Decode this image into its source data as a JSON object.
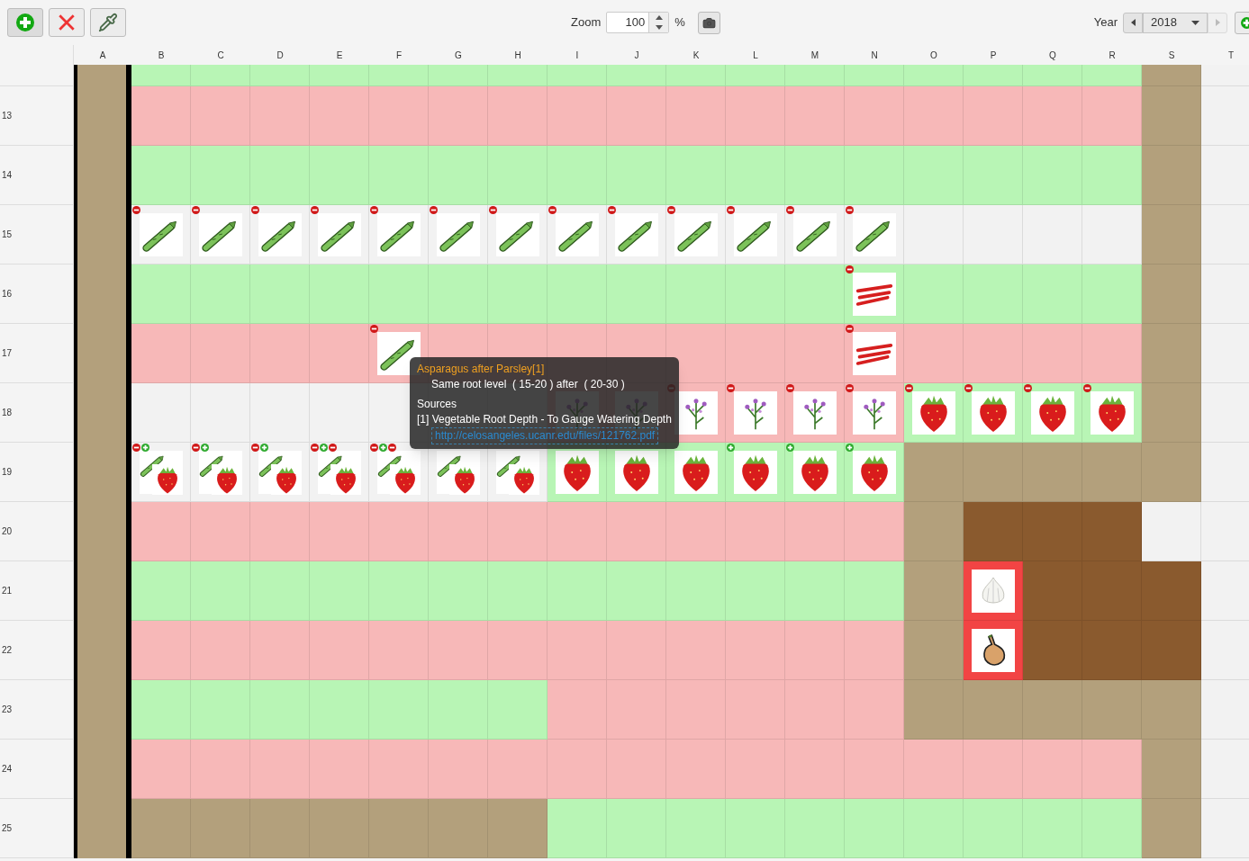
{
  "toolbar": {
    "buttons": [
      {
        "kind": "add"
      },
      {
        "kind": "delete"
      },
      {
        "kind": "pick"
      }
    ],
    "zoom": {
      "label": "Zoom",
      "value": "100",
      "unit": "%"
    },
    "year": {
      "label": "Year",
      "value": "2018",
      "prev_disabled": false,
      "next_disabled": true
    }
  },
  "columns": [
    "A",
    "B",
    "C",
    "D",
    "E",
    "F",
    "G",
    "H",
    "I",
    "J",
    "K",
    "L",
    "M",
    "N",
    "O",
    "P",
    "Q",
    "R",
    "S",
    "T"
  ],
  "rows": [
    {
      "cells": [
        {
          "kind": "path"
        },
        {
          "kind": "green"
        },
        {
          "kind": "green"
        },
        {
          "kind": "green"
        },
        {
          "kind": "green"
        },
        {
          "kind": "green"
        },
        {
          "kind": "green"
        },
        {
          "kind": "green"
        },
        {
          "kind": "green"
        },
        {
          "kind": "green"
        },
        {
          "kind": "green"
        },
        {
          "kind": "green"
        },
        {
          "kind": "green"
        },
        {
          "kind": "green"
        },
        {
          "kind": "green"
        },
        {
          "kind": "green"
        },
        {
          "kind": "green"
        },
        {
          "kind": "green"
        },
        {
          "kind": "path"
        },
        {
          "kind": "empty"
        }
      ]
    },
    {
      "label": "13",
      "cells": [
        {
          "kind": "path"
        },
        {
          "kind": "red"
        },
        {
          "kind": "red"
        },
        {
          "kind": "red"
        },
        {
          "kind": "red"
        },
        {
          "kind": "red"
        },
        {
          "kind": "red"
        },
        {
          "kind": "red"
        },
        {
          "kind": "red"
        },
        {
          "kind": "red"
        },
        {
          "kind": "red"
        },
        {
          "kind": "red"
        },
        {
          "kind": "red"
        },
        {
          "kind": "red"
        },
        {
          "kind": "red"
        },
        {
          "kind": "red"
        },
        {
          "kind": "red"
        },
        {
          "kind": "red"
        },
        {
          "kind": "path"
        },
        {
          "kind": "empty"
        }
      ]
    },
    {
      "label": "14",
      "cells": [
        {
          "kind": "path"
        },
        {
          "kind": "green"
        },
        {
          "kind": "green"
        },
        {
          "kind": "green"
        },
        {
          "kind": "green"
        },
        {
          "kind": "green"
        },
        {
          "kind": "green"
        },
        {
          "kind": "green"
        },
        {
          "kind": "green"
        },
        {
          "kind": "green"
        },
        {
          "kind": "green"
        },
        {
          "kind": "green"
        },
        {
          "kind": "green"
        },
        {
          "kind": "green"
        },
        {
          "kind": "green"
        },
        {
          "kind": "green"
        },
        {
          "kind": "green"
        },
        {
          "kind": "green"
        },
        {
          "kind": "path"
        },
        {
          "kind": "empty"
        }
      ]
    },
    {
      "label": "15",
      "cells": [
        {
          "kind": "path"
        },
        {
          "kind": "empty",
          "plant": {
            "kind": "asparagus"
          },
          "marks": [
            {
              "kind": "minus"
            }
          ]
        },
        {
          "kind": "empty",
          "plant": {
            "kind": "asparagus"
          },
          "marks": [
            {
              "kind": "minus"
            }
          ]
        },
        {
          "kind": "empty",
          "plant": {
            "kind": "asparagus"
          },
          "marks": [
            {
              "kind": "minus"
            }
          ]
        },
        {
          "kind": "empty",
          "plant": {
            "kind": "asparagus"
          },
          "marks": [
            {
              "kind": "minus"
            }
          ]
        },
        {
          "kind": "empty",
          "plant": {
            "kind": "asparagus"
          },
          "marks": [
            {
              "kind": "minus"
            }
          ]
        },
        {
          "kind": "empty",
          "plant": {
            "kind": "asparagus"
          },
          "marks": [
            {
              "kind": "minus"
            }
          ]
        },
        {
          "kind": "empty",
          "plant": {
            "kind": "asparagus"
          },
          "marks": [
            {
              "kind": "minus"
            }
          ]
        },
        {
          "kind": "empty",
          "plant": {
            "kind": "asparagus"
          },
          "marks": [
            {
              "kind": "minus"
            }
          ]
        },
        {
          "kind": "empty",
          "plant": {
            "kind": "asparagus"
          },
          "marks": [
            {
              "kind": "minus"
            }
          ]
        },
        {
          "kind": "empty",
          "plant": {
            "kind": "asparagus"
          },
          "marks": [
            {
              "kind": "minus"
            }
          ]
        },
        {
          "kind": "empty",
          "plant": {
            "kind": "asparagus"
          },
          "marks": [
            {
              "kind": "minus"
            }
          ]
        },
        {
          "kind": "empty",
          "plant": {
            "kind": "asparagus"
          },
          "marks": [
            {
              "kind": "minus"
            }
          ]
        },
        {
          "kind": "empty",
          "plant": {
            "kind": "asparagus"
          },
          "marks": [
            {
              "kind": "minus"
            }
          ]
        },
        {
          "kind": "empty"
        },
        {
          "kind": "empty"
        },
        {
          "kind": "empty"
        },
        {
          "kind": "empty"
        },
        {
          "kind": "path"
        },
        {
          "kind": "empty"
        }
      ]
    },
    {
      "label": "16",
      "cells": [
        {
          "kind": "path"
        },
        {
          "kind": "green"
        },
        {
          "kind": "green"
        },
        {
          "kind": "green"
        },
        {
          "kind": "green"
        },
        {
          "kind": "green"
        },
        {
          "kind": "green"
        },
        {
          "kind": "green"
        },
        {
          "kind": "green"
        },
        {
          "kind": "green"
        },
        {
          "kind": "green"
        },
        {
          "kind": "green"
        },
        {
          "kind": "green"
        },
        {
          "kind": "green",
          "plant": {
            "kind": "rhubarb"
          },
          "marks": [
            {
              "kind": "minus"
            }
          ]
        },
        {
          "kind": "green"
        },
        {
          "kind": "green"
        },
        {
          "kind": "green"
        },
        {
          "kind": "green"
        },
        {
          "kind": "path"
        },
        {
          "kind": "empty"
        }
      ]
    },
    {
      "label": "17",
      "cells": [
        {
          "kind": "path"
        },
        {
          "kind": "red"
        },
        {
          "kind": "red"
        },
        {
          "kind": "red"
        },
        {
          "kind": "red"
        },
        {
          "kind": "red",
          "plant": {
            "kind": "asparagus"
          },
          "marks": [
            {
              "kind": "minus"
            }
          ]
        },
        {
          "kind": "red"
        },
        {
          "kind": "red"
        },
        {
          "kind": "red"
        },
        {
          "kind": "red"
        },
        {
          "kind": "red"
        },
        {
          "kind": "red"
        },
        {
          "kind": "red"
        },
        {
          "kind": "red",
          "plant": {
            "kind": "rhubarb"
          },
          "marks": [
            {
              "kind": "minus"
            }
          ]
        },
        {
          "kind": "red"
        },
        {
          "kind": "red"
        },
        {
          "kind": "red"
        },
        {
          "kind": "red"
        },
        {
          "kind": "path"
        },
        {
          "kind": "empty"
        }
      ]
    },
    {
      "label": "18",
      "cells": [
        {
          "kind": "path"
        },
        {
          "kind": "empty"
        },
        {
          "kind": "empty"
        },
        {
          "kind": "empty"
        },
        {
          "kind": "empty"
        },
        {
          "kind": "empty"
        },
        {
          "kind": "empty"
        },
        {
          "kind": "empty"
        },
        {
          "kind": "red",
          "plant": {
            "kind": "herb"
          }
        },
        {
          "kind": "red",
          "plant": {
            "kind": "herb"
          }
        },
        {
          "kind": "red",
          "plant": {
            "kind": "herb"
          },
          "marks": [
            {
              "kind": "minus"
            }
          ]
        },
        {
          "kind": "red",
          "plant": {
            "kind": "herb"
          },
          "marks": [
            {
              "kind": "minus"
            }
          ]
        },
        {
          "kind": "red",
          "plant": {
            "kind": "herb"
          },
          "marks": [
            {
              "kind": "minus"
            }
          ]
        },
        {
          "kind": "red",
          "plant": {
            "kind": "herb"
          },
          "marks": [
            {
              "kind": "minus"
            }
          ]
        },
        {
          "kind": "green",
          "plant": {
            "kind": "strawberry"
          },
          "marks": [
            {
              "kind": "minus"
            }
          ]
        },
        {
          "kind": "green",
          "plant": {
            "kind": "strawberry"
          },
          "marks": [
            {
              "kind": "minus"
            }
          ]
        },
        {
          "kind": "green",
          "plant": {
            "kind": "strawberry"
          },
          "marks": [
            {
              "kind": "minus"
            }
          ]
        },
        {
          "kind": "green",
          "plant": {
            "kind": "strawberry"
          },
          "marks": [
            {
              "kind": "minus"
            }
          ]
        },
        {
          "kind": "path"
        },
        {
          "kind": "empty"
        }
      ]
    },
    {
      "label": "19",
      "cells": [
        {
          "kind": "path"
        },
        {
          "kind": "empty",
          "plant": {
            "kind": "asparagus_strawberry"
          },
          "marks": [
            {
              "kind": "minus"
            },
            {
              "kind": "plus"
            }
          ]
        },
        {
          "kind": "empty",
          "plant": {
            "kind": "asparagus_strawberry"
          },
          "marks": [
            {
              "kind": "minus"
            },
            {
              "kind": "plus"
            }
          ]
        },
        {
          "kind": "empty",
          "plant": {
            "kind": "asparagus_strawberry"
          },
          "marks": [
            {
              "kind": "minus"
            },
            {
              "kind": "plus"
            }
          ]
        },
        {
          "kind": "empty",
          "plant": {
            "kind": "asparagus_strawberry"
          },
          "marks": [
            {
              "kind": "minus"
            },
            {
              "kind": "plus"
            },
            {
              "kind": "minus"
            }
          ]
        },
        {
          "kind": "empty",
          "plant": {
            "kind": "asparagus_strawberry"
          },
          "marks": [
            {
              "kind": "minus"
            },
            {
              "kind": "plus"
            },
            {
              "kind": "minus"
            }
          ]
        },
        {
          "kind": "empty",
          "plant": {
            "kind": "asparagus_strawberry"
          }
        },
        {
          "kind": "empty",
          "plant": {
            "kind": "asparagus_strawberry"
          }
        },
        {
          "kind": "green",
          "plant": {
            "kind": "strawberry"
          }
        },
        {
          "kind": "green",
          "plant": {
            "kind": "strawberry"
          }
        },
        {
          "kind": "green",
          "plant": {
            "kind": "strawberry"
          }
        },
        {
          "kind": "green",
          "plant": {
            "kind": "strawberry"
          },
          "marks": [
            {
              "kind": "plus"
            }
          ]
        },
        {
          "kind": "green",
          "plant": {
            "kind": "strawberry"
          },
          "marks": [
            {
              "kind": "plus"
            }
          ]
        },
        {
          "kind": "green",
          "plant": {
            "kind": "strawberry"
          },
          "marks": [
            {
              "kind": "plus"
            }
          ]
        },
        {
          "kind": "path"
        },
        {
          "kind": "path"
        },
        {
          "kind": "path"
        },
        {
          "kind": "path"
        },
        {
          "kind": "path"
        },
        {
          "kind": "empty"
        }
      ]
    },
    {
      "label": "20",
      "cells": [
        {
          "kind": "path"
        },
        {
          "kind": "red"
        },
        {
          "kind": "red"
        },
        {
          "kind": "red"
        },
        {
          "kind": "red"
        },
        {
          "kind": "red"
        },
        {
          "kind": "red"
        },
        {
          "kind": "red"
        },
        {
          "kind": "red"
        },
        {
          "kind": "red"
        },
        {
          "kind": "red"
        },
        {
          "kind": "red"
        },
        {
          "kind": "red"
        },
        {
          "kind": "red"
        },
        {
          "kind": "path"
        },
        {
          "kind": "soil"
        },
        {
          "kind": "soil"
        },
        {
          "kind": "soil"
        },
        {
          "kind": "empty"
        },
        {
          "kind": "empty"
        }
      ]
    },
    {
      "label": "21",
      "cells": [
        {
          "kind": "path"
        },
        {
          "kind": "green"
        },
        {
          "kind": "green"
        },
        {
          "kind": "green"
        },
        {
          "kind": "green"
        },
        {
          "kind": "green"
        },
        {
          "kind": "green"
        },
        {
          "kind": "green"
        },
        {
          "kind": "green"
        },
        {
          "kind": "green"
        },
        {
          "kind": "green"
        },
        {
          "kind": "green"
        },
        {
          "kind": "green"
        },
        {
          "kind": "green"
        },
        {
          "kind": "path"
        },
        {
          "kind": "alert",
          "plant": {
            "kind": "garlic"
          }
        },
        {
          "kind": "soil"
        },
        {
          "kind": "soil"
        },
        {
          "kind": "soil"
        },
        {
          "kind": "empty"
        }
      ]
    },
    {
      "label": "22",
      "cells": [
        {
          "kind": "path"
        },
        {
          "kind": "red"
        },
        {
          "kind": "red"
        },
        {
          "kind": "red"
        },
        {
          "kind": "red"
        },
        {
          "kind": "red"
        },
        {
          "kind": "red"
        },
        {
          "kind": "red"
        },
        {
          "kind": "red"
        },
        {
          "kind": "red"
        },
        {
          "kind": "red"
        },
        {
          "kind": "red"
        },
        {
          "kind": "red"
        },
        {
          "kind": "red"
        },
        {
          "kind": "path"
        },
        {
          "kind": "alert",
          "plant": {
            "kind": "onion"
          }
        },
        {
          "kind": "soil"
        },
        {
          "kind": "soil"
        },
        {
          "kind": "soil"
        },
        {
          "kind": "empty"
        }
      ]
    },
    {
      "label": "23",
      "cells": [
        {
          "kind": "path"
        },
        {
          "kind": "green"
        },
        {
          "kind": "green"
        },
        {
          "kind": "green"
        },
        {
          "kind": "green"
        },
        {
          "kind": "green"
        },
        {
          "kind": "green"
        },
        {
          "kind": "green"
        },
        {
          "kind": "red"
        },
        {
          "kind": "red"
        },
        {
          "kind": "red"
        },
        {
          "kind": "red"
        },
        {
          "kind": "red"
        },
        {
          "kind": "red"
        },
        {
          "kind": "path"
        },
        {
          "kind": "path"
        },
        {
          "kind": "path"
        },
        {
          "kind": "path"
        },
        {
          "kind": "path"
        },
        {
          "kind": "empty"
        }
      ]
    },
    {
      "label": "24",
      "cells": [
        {
          "kind": "path"
        },
        {
          "kind": "red"
        },
        {
          "kind": "red"
        },
        {
          "kind": "red"
        },
        {
          "kind": "red"
        },
        {
          "kind": "red"
        },
        {
          "kind": "red"
        },
        {
          "kind": "red"
        },
        {
          "kind": "red"
        },
        {
          "kind": "red"
        },
        {
          "kind": "red"
        },
        {
          "kind": "red"
        },
        {
          "kind": "red"
        },
        {
          "kind": "red"
        },
        {
          "kind": "red"
        },
        {
          "kind": "red"
        },
        {
          "kind": "red"
        },
        {
          "kind": "red"
        },
        {
          "kind": "path"
        },
        {
          "kind": "empty"
        }
      ]
    },
    {
      "label": "25",
      "cells": [
        {
          "kind": "path"
        },
        {
          "kind": "path"
        },
        {
          "kind": "path"
        },
        {
          "kind": "path"
        },
        {
          "kind": "path"
        },
        {
          "kind": "path"
        },
        {
          "kind": "path"
        },
        {
          "kind": "path"
        },
        {
          "kind": "green"
        },
        {
          "kind": "green"
        },
        {
          "kind": "green"
        },
        {
          "kind": "green"
        },
        {
          "kind": "green"
        },
        {
          "kind": "green"
        },
        {
          "kind": "green"
        },
        {
          "kind": "green"
        },
        {
          "kind": "green"
        },
        {
          "kind": "green"
        },
        {
          "kind": "path"
        },
        {
          "kind": "empty"
        }
      ]
    }
  ],
  "tooltip": {
    "title": "Asparagus after Parsley[1]",
    "detail": "Same root level  ( 15-20 ) after  ( 20-30 )",
    "sources_label": "Sources",
    "source": "[1] Vegetable Root Depth - To Gauge Watering Depth",
    "link": "http://celosangeles.ucanr.edu/files/121762.pdf"
  }
}
